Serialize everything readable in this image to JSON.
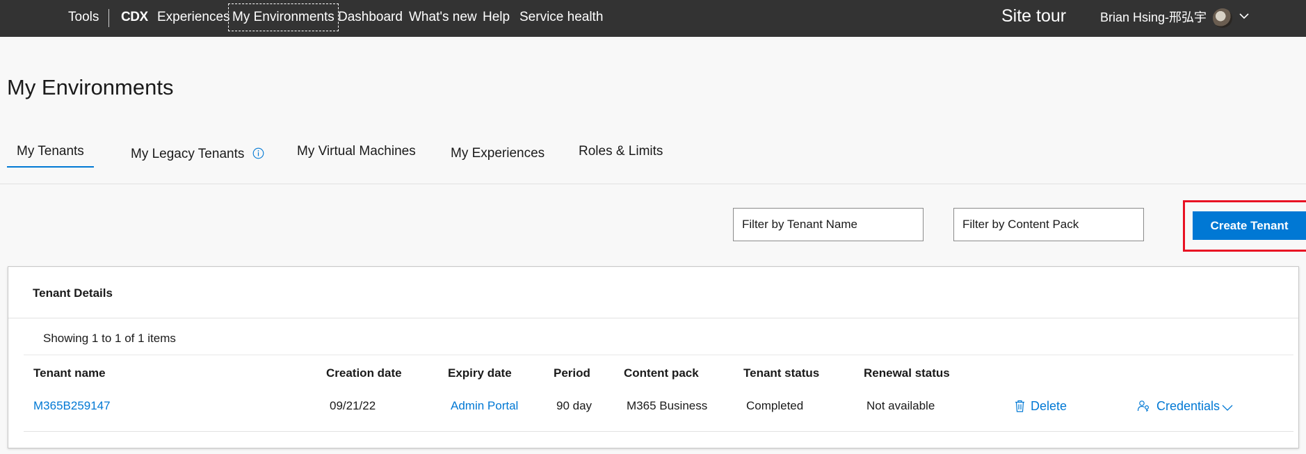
{
  "topnav": {
    "items": [
      {
        "label": "Tools"
      },
      {
        "label": "CDX"
      },
      {
        "label": "Experiences"
      },
      {
        "label": "My Environments"
      },
      {
        "label": "Dashboard"
      },
      {
        "label": "What's new"
      },
      {
        "label": "Help"
      },
      {
        "label": "Service health"
      }
    ],
    "site_tour": "Site tour",
    "user_name": "Brian Hsing-邢弘宇",
    "avatar_icon": "user-avatar",
    "caret_icon": "chevron-down-icon"
  },
  "page": {
    "title": "My Environments"
  },
  "tabs": [
    {
      "label": "My Tenants",
      "active": true
    },
    {
      "label": "My Legacy Tenants",
      "icon": "info-icon"
    },
    {
      "label": "My Virtual Machines"
    },
    {
      "label": "My Experiences"
    },
    {
      "label": "Roles & Limits"
    }
  ],
  "filters": {
    "tenant_name_placeholder": "Filter by Tenant Name",
    "content_pack_placeholder": "Filter by Content Pack"
  },
  "create_button": "Create Tenant",
  "panel": {
    "title": "Tenant Details",
    "showing": "Showing 1 to 1 of 1 items",
    "columns": [
      "Tenant name",
      "Creation date",
      "Expiry date",
      "Period",
      "Content pack",
      "Tenant status",
      "Renewal status"
    ],
    "rows": [
      {
        "tenant_name": "M365B259147",
        "creation_date": "09/21/22",
        "expiry_date": "Admin Portal",
        "period": "90 day",
        "content_pack": "M365 Business",
        "tenant_status": "Completed",
        "renewal_status": "Not available",
        "delete_label": "Delete",
        "credentials_label": "Credentials"
      }
    ]
  },
  "colors": {
    "nav_bg": "#333333",
    "accent": "#0078d4",
    "highlight": "#e81123"
  }
}
